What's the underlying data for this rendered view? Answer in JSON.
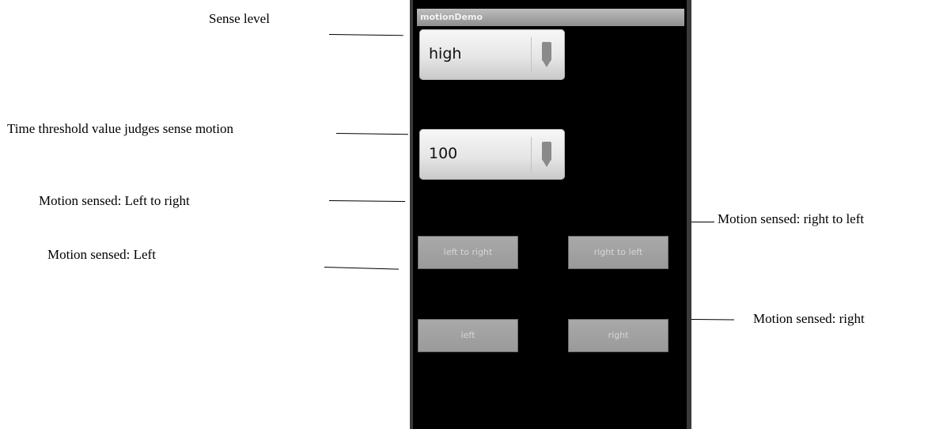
{
  "app": {
    "title": "motionDemo"
  },
  "spinners": {
    "sense_level": "high",
    "time_threshold": "100"
  },
  "buttons": {
    "left_to_right": "left to right",
    "right_to_left": "right to left",
    "left": "left",
    "right": "right"
  },
  "annotations": {
    "sense_level": "Sense level",
    "time_threshold": "Time threshold value judges sense motion",
    "motion_left_to_right": "Motion sensed: Left to right",
    "motion_left": "Motion sensed: Left",
    "motion_right_to_left": "Motion sensed: right to left",
    "motion_right": "Motion sensed: right"
  },
  "colors": {
    "phone_bg": "#000000",
    "button_bg": "#a9a9a9",
    "titlebar_bg": "#9e9e9e"
  },
  "icons": {
    "spinner_arrow": "dropdown-arrow-icon"
  }
}
